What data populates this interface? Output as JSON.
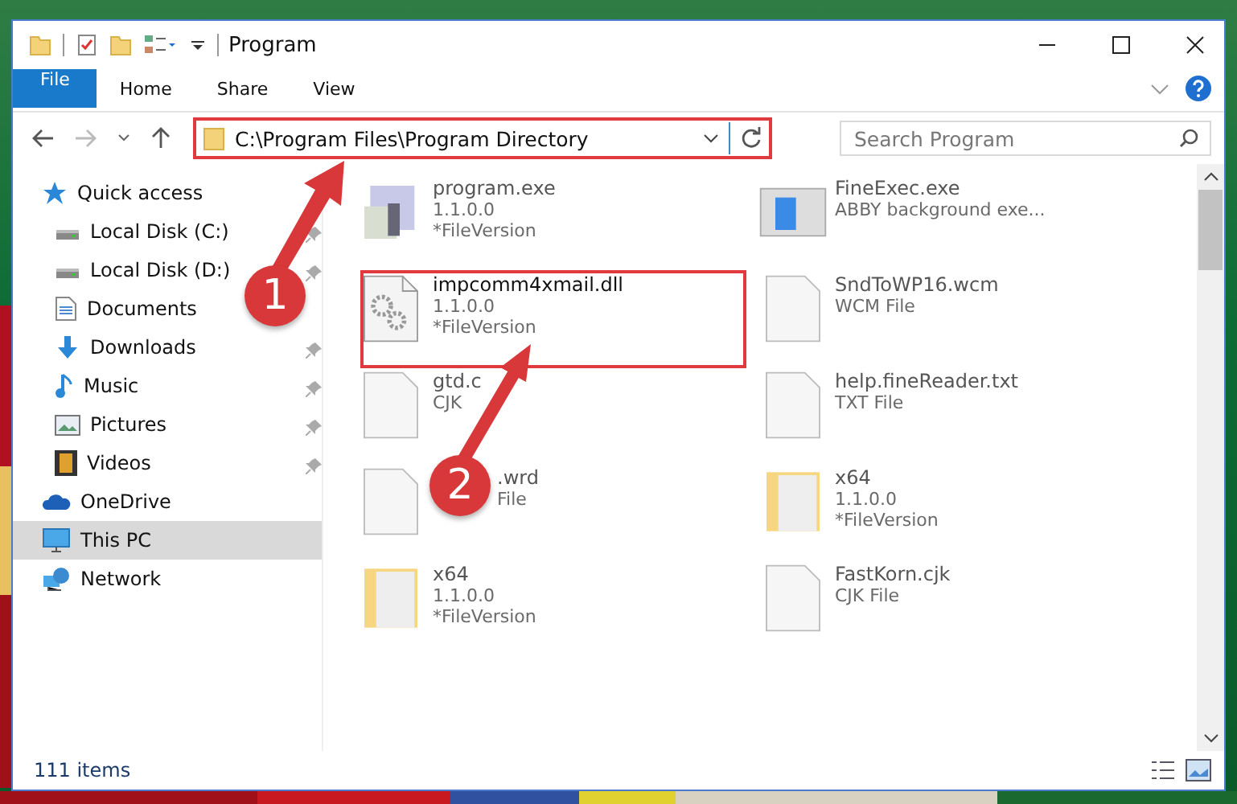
{
  "window": {
    "title": "Program"
  },
  "ribbon": {
    "tabs": [
      {
        "label": "File",
        "kind": "file"
      },
      {
        "label": "Home",
        "kind": "tab"
      },
      {
        "label": "Share",
        "kind": "tab"
      },
      {
        "label": "View",
        "kind": "tab"
      }
    ]
  },
  "address_bar": {
    "path": "C:\\Program Files\\Program Directory"
  },
  "search": {
    "placeholder": "Search Program"
  },
  "sidebar": {
    "items": [
      {
        "label": "Quick access",
        "selected": false,
        "children": [
          {
            "label": "Local Disk (C:)",
            "pinned": true
          },
          {
            "label": "Local Disk (D:)",
            "pinned": true
          },
          {
            "label": "Documents",
            "pinned": false
          },
          {
            "label": "Downloads",
            "pinned": true
          },
          {
            "label": "Music",
            "pinned": true
          },
          {
            "label": "Pictures",
            "pinned": true
          },
          {
            "label": "Videos",
            "pinned": true
          }
        ]
      },
      {
        "label": "OneDrive",
        "selected": false
      },
      {
        "label": "This PC",
        "selected": true
      },
      {
        "label": "Network",
        "selected": false
      }
    ]
  },
  "files": [
    {
      "kind": "exe",
      "name": "program.exe",
      "lines": [
        "1.1.0.0",
        "*FileVersion"
      ],
      "faded": true
    },
    {
      "kind": "app",
      "name": "FineExec.exe",
      "lines": [
        "ABBY background exe..."
      ],
      "faded": true
    },
    {
      "kind": "dll",
      "name": "impcomm4xmail.dll",
      "lines": [
        "1.1.0.0",
        "*FileVersion"
      ],
      "faded": false
    },
    {
      "kind": "file",
      "name": "SndToWP16.wcm",
      "lines": [
        "WCM File"
      ],
      "faded": true
    },
    {
      "kind": "file",
      "name": "gtd.c",
      "lines": [
        "CJK"
      ],
      "faded": true
    },
    {
      "kind": "file",
      "name": "help.fineReader.txt",
      "lines": [
        "TXT File"
      ],
      "faded": true
    },
    {
      "kind": "file",
      "name": ".wrd",
      "lines": [
        "File"
      ],
      "faded": true
    },
    {
      "kind": "folder",
      "name": "x64",
      "lines": [
        "1.1.0.0",
        "*FileVersion"
      ],
      "faded": true
    },
    {
      "kind": "folder",
      "name": "x64",
      "lines": [
        "1.1.0.0",
        "*FileVersion"
      ],
      "faded": true
    },
    {
      "kind": "file",
      "name": "FastKorn.cjk",
      "lines": [
        "CJK File"
      ],
      "faded": true
    }
  ],
  "status_bar": {
    "count": "111 items"
  },
  "annotations": [
    {
      "label": "1"
    },
    {
      "label": "2"
    }
  ]
}
